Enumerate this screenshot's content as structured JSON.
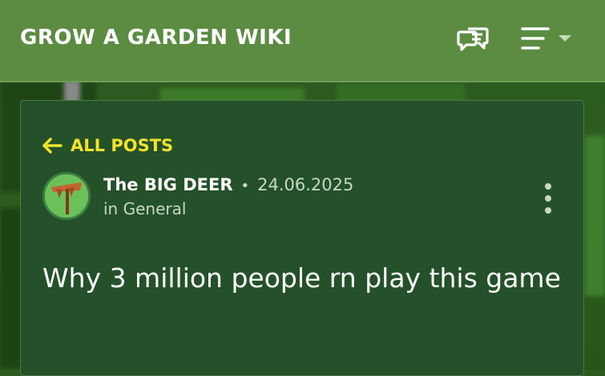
{
  "header": {
    "site_title": "GROW A GARDEN WIKI",
    "discussions_icon": "discussions-icon",
    "menu_icon": "hamburger-menu-icon",
    "dropdown_icon": "caret-down-icon"
  },
  "post": {
    "back_label": "ALL POSTS",
    "author": "The BIG DEER",
    "separator": "•",
    "date": "24.06.2025",
    "category_prefix": "in",
    "category": "General",
    "title": "Why 3 million people rn play this game",
    "more_icon": "vertical-ellipsis-icon"
  },
  "colors": {
    "header_bg": "#5b8c42",
    "card_bg": "#245129",
    "accent_yellow": "#f2e22a",
    "text_muted": "#c9d6c6"
  }
}
